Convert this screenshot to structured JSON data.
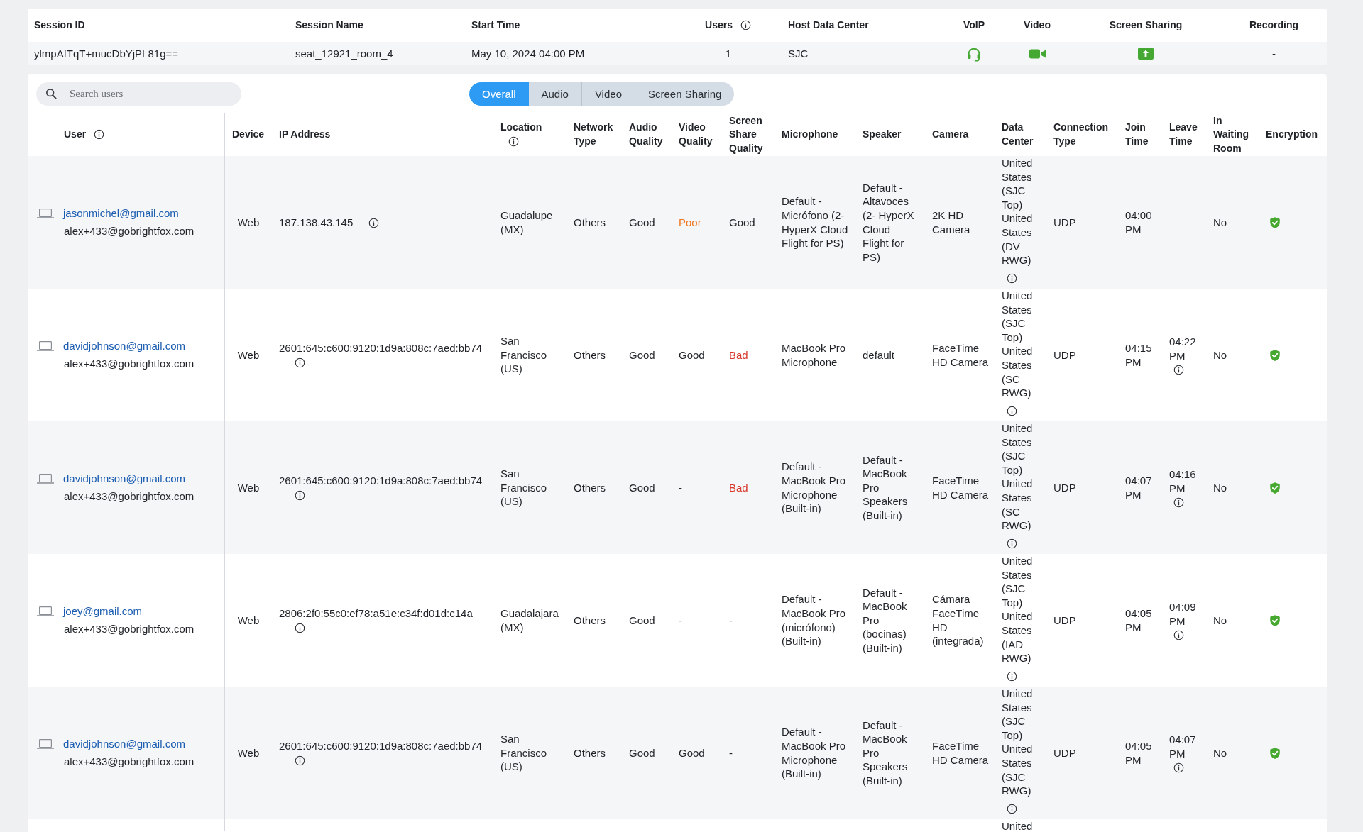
{
  "session_table": {
    "columns": [
      {
        "label": "Session ID",
        "info": false
      },
      {
        "label": "Session Name",
        "info": false
      },
      {
        "label": "Start Time",
        "info": false
      },
      {
        "label": "Users",
        "info": true
      },
      {
        "label": "Host Data Center",
        "info": false
      },
      {
        "label": "VoIP",
        "info": false
      },
      {
        "label": "Video",
        "info": false
      },
      {
        "label": "Screen Sharing",
        "info": false
      },
      {
        "label": "Recording",
        "info": false
      }
    ],
    "row": {
      "session_id": "ylmpAfTqT+mucDbYjPL81g==",
      "session_name": "seat_12921_room_4",
      "start_time": "May 10, 2024 04:00 PM",
      "users": "1",
      "host_data_center": "SJC",
      "voip": true,
      "video": true,
      "screen_sharing": true,
      "recording": "-"
    }
  },
  "search": {
    "placeholder": "Search users"
  },
  "tabs": [
    {
      "label": "Overall",
      "selected": true
    },
    {
      "label": "Audio",
      "selected": false
    },
    {
      "label": "Video",
      "selected": false
    },
    {
      "label": "Screen Sharing",
      "selected": false
    }
  ],
  "users_table": {
    "columns": [
      {
        "label": "User",
        "info": true
      },
      {
        "label": "Device",
        "info": false
      },
      {
        "label": "IP Address",
        "info": false
      },
      {
        "label": "Location",
        "info": true
      },
      {
        "label": "Network Type",
        "info": false
      },
      {
        "label": "Audio Quality",
        "info": false
      },
      {
        "label": "Video Quality",
        "info": false
      },
      {
        "label": "Screen Share Quality",
        "info": false
      },
      {
        "label": "Microphone",
        "info": false
      },
      {
        "label": "Speaker",
        "info": false
      },
      {
        "label": "Camera",
        "info": false
      },
      {
        "label": "Data Center",
        "info": false
      },
      {
        "label": "Connection Type",
        "info": false
      },
      {
        "label": "Join Time",
        "info": false
      },
      {
        "label": "Leave Time",
        "info": false
      },
      {
        "label": "In Waiting Room",
        "info": false
      },
      {
        "label": "Encryption",
        "info": false
      }
    ],
    "rows": [
      {
        "user_email": "jasonmichel@gmail.com",
        "user_account": "alex+433@gobrightfox.com",
        "device": "Web",
        "ip_address": "187.138.43.145",
        "location": "Guadalupe (MX)",
        "network_type": "Others",
        "audio_quality": {
          "text": "Good",
          "color": "#1f2328"
        },
        "video_quality": {
          "text": "Poor",
          "color": "#f0761c"
        },
        "screen_share_quality": {
          "text": "Good",
          "color": "#1f2328"
        },
        "microphone": "Default - Micrófono (2- HyperX Cloud Flight for PS)",
        "speaker": "Default - Altavoces (2- HyperX Cloud Flight for PS)",
        "camera": "2K HD Camera",
        "data_center": "United States (SJC Top) United States (DV RWG)",
        "connection_type": "UDP",
        "join_time": "04:00 PM",
        "in_waiting_room": "No",
        "encrypted": true
      },
      {
        "user_email": "davidjohnson@gmail.com",
        "user_account": "alex+433@gobrightfox.com",
        "device": "Web",
        "ip_address": "2601:645:c600:9120:1d9a:808c:7aed:bb74",
        "location": "San Francisco (US)",
        "network_type": "Others",
        "audio_quality": {
          "text": "Good",
          "color": "#1f2328"
        },
        "video_quality": {
          "text": "Good",
          "color": "#1f2328"
        },
        "screen_share_quality": {
          "text": "Bad",
          "color": "#d8372b"
        },
        "microphone": "MacBook Pro Microphone",
        "speaker": "default",
        "camera": "FaceTime HD Camera",
        "data_center": "United States (SJC Top) United States (SC RWG)",
        "connection_type": "UDP",
        "join_time": "04:15 PM",
        "leave_time": "04:22 PM",
        "in_waiting_room": "No",
        "encrypted": true
      },
      {
        "user_email": "davidjohnson@gmail.com",
        "user_account": "alex+433@gobrightfox.com",
        "device": "Web",
        "ip_address": "2601:645:c600:9120:1d9a:808c:7aed:bb74",
        "location": "San Francisco (US)",
        "network_type": "Others",
        "audio_quality": {
          "text": "Good",
          "color": "#1f2328"
        },
        "video_quality": {
          "text": "-",
          "color": "#1f2328"
        },
        "screen_share_quality": {
          "text": "Bad",
          "color": "#d8372b"
        },
        "microphone": "Default - MacBook Pro Microphone (Built-in)",
        "speaker": "Default - MacBook Pro Speakers (Built-in)",
        "camera": "FaceTime HD Camera",
        "data_center": "United States (SJC Top) United States (SC RWG)",
        "connection_type": "UDP",
        "join_time": "04:07 PM",
        "leave_time": "04:16 PM",
        "in_waiting_room": "No",
        "encrypted": true
      },
      {
        "user_email": "joey@gmail.com",
        "user_account": "alex+433@gobrightfox.com",
        "device": "Web",
        "ip_address": "2806:2f0:55c0:ef78:a51e:c34f:d01d:c14a",
        "location": "Guadalajara (MX)",
        "network_type": "Others",
        "audio_quality": {
          "text": "Good",
          "color": "#1f2328"
        },
        "video_quality": {
          "text": "-",
          "color": "#1f2328"
        },
        "screen_share_quality": {
          "text": "-",
          "color": "#1f2328"
        },
        "microphone": "Default - MacBook Pro (micrófono) (Built-in)",
        "speaker": "Default - MacBook Pro (bocinas) (Built-in)",
        "camera": "Cámara FaceTime HD (integrada)",
        "data_center": "United States (SJC Top) United States (IAD RWG)",
        "connection_type": "UDP",
        "join_time": "04:05 PM",
        "leave_time": "04:09 PM",
        "in_waiting_room": "No",
        "encrypted": true
      },
      {
        "user_email": "davidjohnson@gmail.com",
        "user_account": "alex+433@gobrightfox.com",
        "device": "Web",
        "ip_address": "2601:645:c600:9120:1d9a:808c:7aed:bb74",
        "location": "San Francisco (US)",
        "network_type": "Others",
        "audio_quality": {
          "text": "Good",
          "color": "#1f2328"
        },
        "video_quality": {
          "text": "Good",
          "color": "#1f2328"
        },
        "screen_share_quality": {
          "text": "-",
          "color": "#1f2328"
        },
        "microphone": "Default - MacBook Pro Microphone (Built-in)",
        "speaker": "Default - MacBook Pro Speakers (Built-in)",
        "camera": "FaceTime HD Camera",
        "data_center": "United States (SJC Top) United States (SJC RWG)",
        "connection_type": "UDP",
        "join_time": "04:05 PM",
        "leave_time": "04:07 PM",
        "in_waiting_room": "No",
        "encrypted": true
      }
    ],
    "cut_off_row": {
      "data_center": "United"
    }
  }
}
